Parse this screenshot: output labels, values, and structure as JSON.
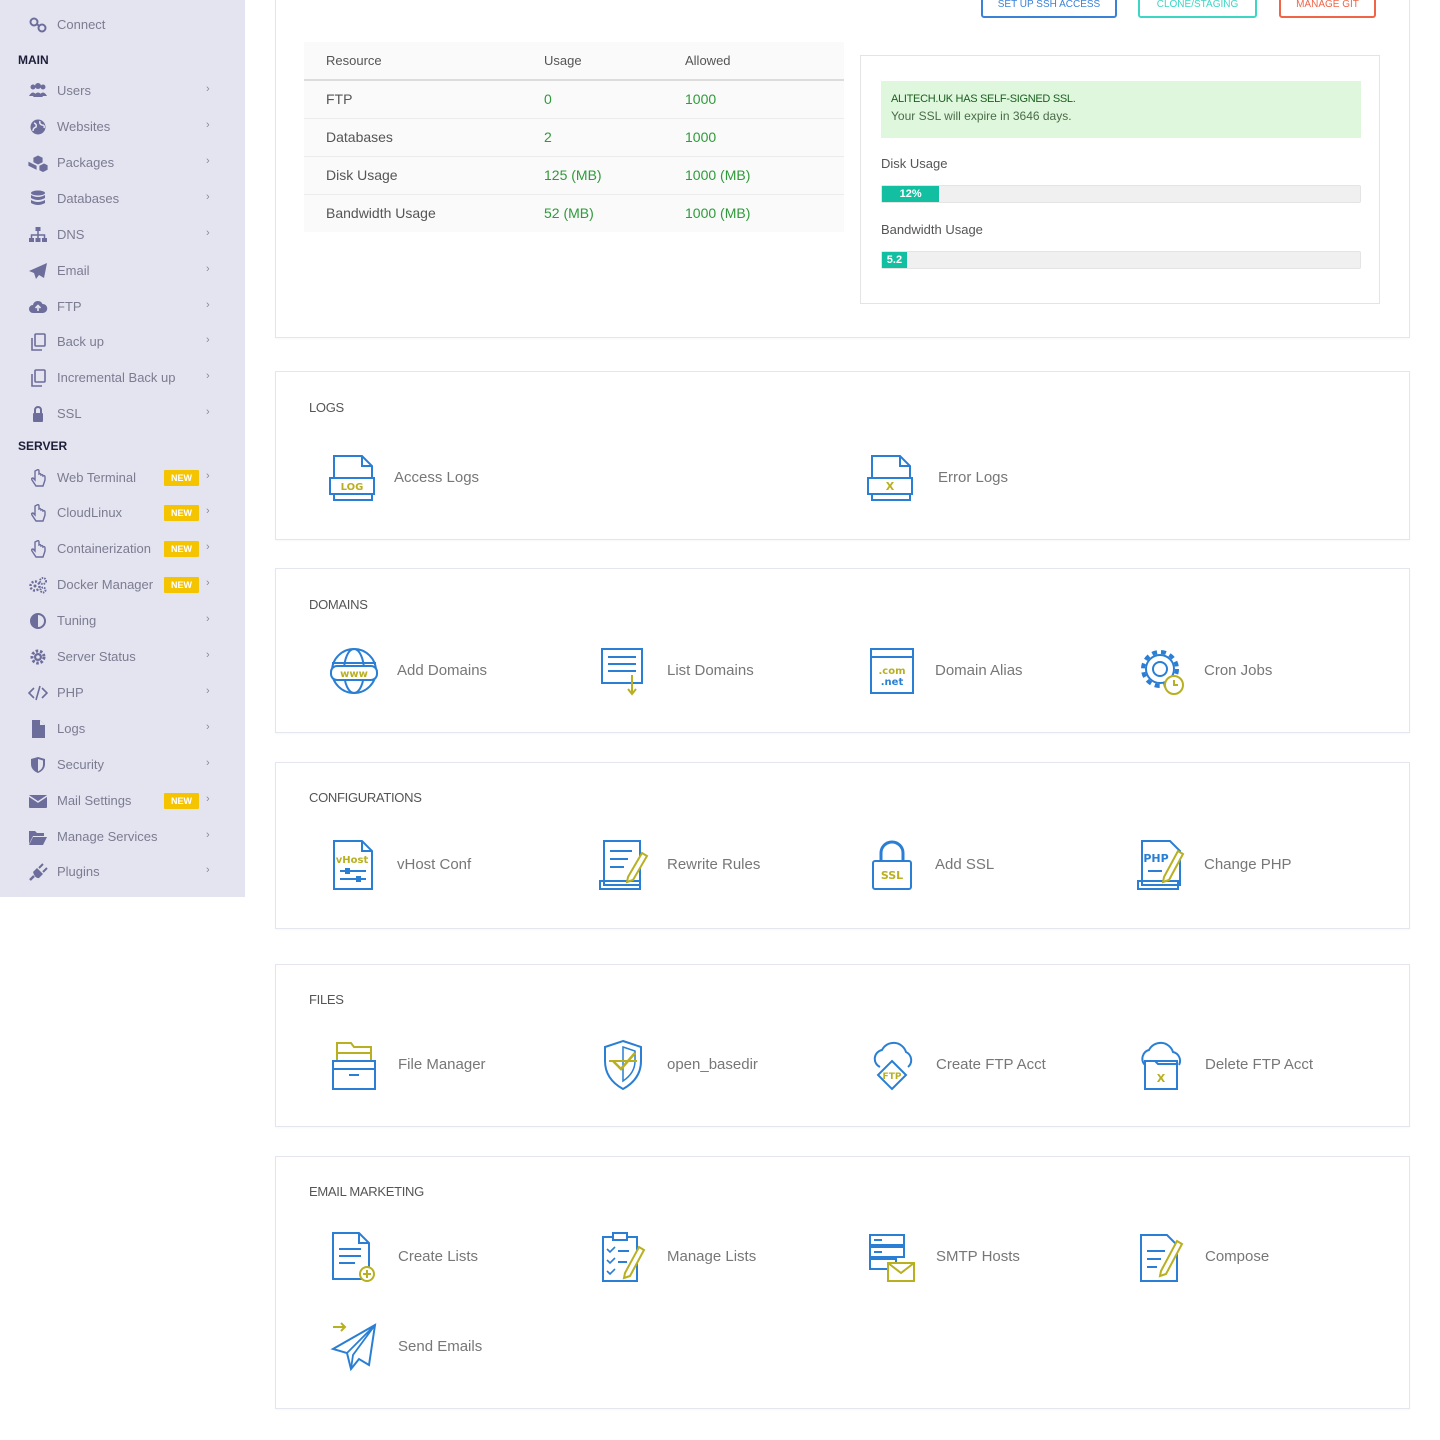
{
  "sidebar": {
    "connect": "Connect",
    "sections": {
      "main": "MAIN",
      "server": "SERVER"
    },
    "main_items": [
      {
        "label": "Users",
        "icon": "users-icon"
      },
      {
        "label": "Websites",
        "icon": "globe-icon"
      },
      {
        "label": "Packages",
        "icon": "cubes-icon"
      },
      {
        "label": "Databases",
        "icon": "database-icon"
      },
      {
        "label": "DNS",
        "icon": "sitemap-icon"
      },
      {
        "label": "Email",
        "icon": "paper-plane-icon"
      },
      {
        "label": "FTP",
        "icon": "cloud-upload-icon"
      },
      {
        "label": "Back up",
        "icon": "copy-icon"
      },
      {
        "label": "Incremental Back up",
        "icon": "copy-icon"
      },
      {
        "label": "SSL",
        "icon": "lock-icon"
      }
    ],
    "server_items": [
      {
        "label": "Web Terminal",
        "icon": "hand-pointer-icon",
        "badge": "NEW"
      },
      {
        "label": "CloudLinux",
        "icon": "hand-pointer-icon",
        "badge": "NEW"
      },
      {
        "label": "Containerization",
        "icon": "hand-pointer-icon",
        "badge": "NEW"
      },
      {
        "label": "Docker Manager",
        "icon": "cogs-icon",
        "badge": "NEW"
      },
      {
        "label": "Tuning",
        "icon": "adjust-icon"
      },
      {
        "label": "Server Status",
        "icon": "gear-icon"
      },
      {
        "label": "PHP",
        "icon": "code-icon"
      },
      {
        "label": "Logs",
        "icon": "file-icon"
      },
      {
        "label": "Security",
        "icon": "shield-icon"
      },
      {
        "label": "Mail Settings",
        "icon": "envelope-icon",
        "badge": "NEW"
      },
      {
        "label": "Manage Services",
        "icon": "folder-open-icon"
      },
      {
        "label": "Plugins",
        "icon": "plug-icon"
      }
    ]
  },
  "top_buttons": {
    "ssh": "SET UP SSH ACCESS",
    "clone": "CLONE/STAGING",
    "git": "MANAGE GIT"
  },
  "resources": {
    "headers": [
      "Resource",
      "Usage",
      "Allowed"
    ],
    "rows": [
      [
        "FTP",
        "0",
        "1000"
      ],
      [
        "Databases",
        "2",
        "1000"
      ],
      [
        "Disk Usage",
        "125 (MB)",
        "1000 (MB)"
      ],
      [
        "Bandwidth Usage",
        "52 (MB)",
        "1000 (MB)"
      ]
    ]
  },
  "ssl": {
    "title": "ALITECH.UK HAS SELF-SIGNED SSL.",
    "message": "Your SSL will expire in 3646 days."
  },
  "disk_usage": {
    "label": "Disk Usage",
    "percent": 12,
    "text": "12%"
  },
  "bandwidth_usage": {
    "label": "Bandwidth Usage",
    "percent": 5.2,
    "text": "5.2"
  },
  "logs": {
    "title": "LOGS",
    "items": [
      "Access Logs",
      "Error Logs"
    ]
  },
  "domains": {
    "title": "DOMAINS",
    "items": [
      "Add Domains",
      "List Domains",
      "Domain Alias",
      "Cron Jobs"
    ]
  },
  "configurations": {
    "title": "CONFIGURATIONS",
    "items": [
      "vHost Conf",
      "Rewrite Rules",
      "Add SSL",
      "Change PHP"
    ]
  },
  "files": {
    "title": "FILES",
    "items": [
      "File Manager",
      "open_basedir",
      "Create FTP Acct",
      "Delete FTP Acct"
    ]
  },
  "email_marketing": {
    "title": "EMAIL MARKETING",
    "items": [
      "Create Lists",
      "Manage Lists",
      "SMTP Hosts",
      "Compose",
      "Send Emails"
    ]
  },
  "icon_text": {
    "log": "LOG",
    "x": "X",
    "www": "www",
    "com": ".com",
    "net": ".net",
    "vhost": "vHost",
    "ssl": "SSL",
    "php": "PHP",
    "ftp": "FTP"
  },
  "colors": {
    "accent_blue": "#2a7fd4",
    "accent_olive": "#b8b020",
    "teal": "#13bfa1",
    "badge": "#f5c400",
    "ssh_btn": "#3b82d6",
    "clone_btn": "#3dd6c4",
    "git_btn": "#f06548"
  }
}
